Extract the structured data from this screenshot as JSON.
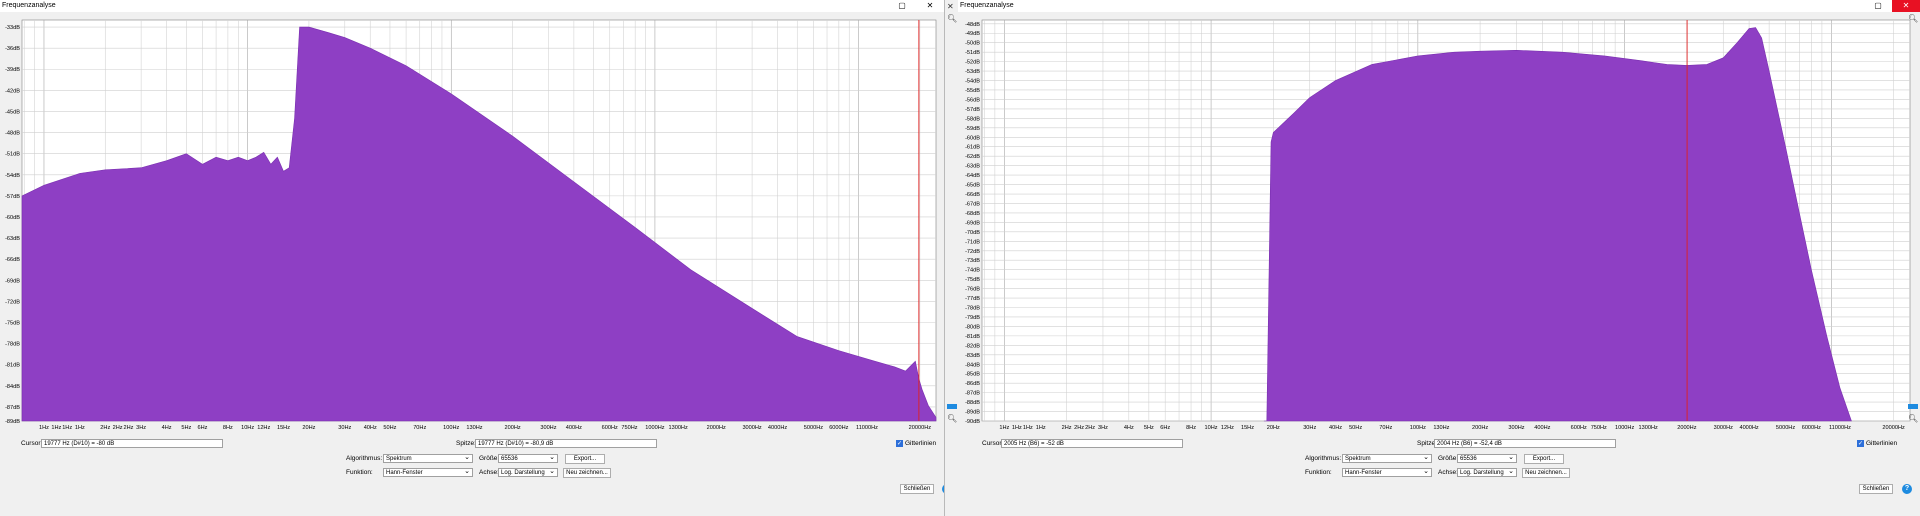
{
  "left": {
    "title": "Frequenzanalyse",
    "cursor_label": "Cursor:",
    "cursor_value": "19777 Hz (D#10) = -80 dB",
    "peak_label": "Spitze:",
    "peak_value": "19777 Hz (D#10) = -80,9 dB",
    "grid_label": "Gitterlinien",
    "algorithm_label": "Algorithmus:",
    "algorithm_value": "Spektrum",
    "size_label": "Größe:",
    "size_value": "65536",
    "export_label": "Export...",
    "function_label": "Funktion:",
    "function_value": "Hann-Fenster",
    "axis_label": "Achse:",
    "axis_value": "Log. Darstellung",
    "redraw_label": "Neu zeichnen...",
    "close_label": "Schließen",
    "help_label": "?"
  },
  "right": {
    "title": "Frequenzanalyse",
    "cursor_label": "Cursor:",
    "cursor_value": "2005 Hz (B6) = -52 dB",
    "peak_label": "Spitze:",
    "peak_value": "2004 Hz (B6) = -52,4 dB",
    "grid_label": "Gitterlinien",
    "algorithm_label": "Algorithmus:",
    "algorithm_value": "Spektrum",
    "size_label": "Größe:",
    "size_value": "65536",
    "export_label": "Export...",
    "function_label": "Funktion:",
    "function_value": "Hann-Fenster",
    "axis_label": "Achse:",
    "axis_value": "Log. Darstellung",
    "redraw_label": "Neu zeichnen...",
    "close_label": "Schließen",
    "help_label": "?"
  },
  "colors": {
    "spectrum_fill": "#8e3fc4",
    "cursor_line": "#e02020",
    "grid": "#c8c8c8",
    "accent": "#1e8be0"
  },
  "icons": {
    "maximize": "maximize-icon",
    "close": "close-icon",
    "zoom": "magnifier-icon"
  },
  "chart_data": [
    {
      "type": "area",
      "yticks": [
        "-33dB",
        "-36dB",
        "-39dB",
        "-42dB",
        "-45dB",
        "-48dB",
        "-51dB",
        "-54dB",
        "-57dB",
        "-60dB",
        "-63dB",
        "-66dB",
        "-69dB",
        "-72dB",
        "-75dB",
        "-78dB",
        "-81dB",
        "-84dB",
        "-87dB",
        "-89dB"
      ],
      "xticks": [
        "1Hz",
        "1Hz",
        "1Hz",
        "1Hz",
        "2Hz",
        "2Hz",
        "2Hz",
        "3Hz",
        "4Hz",
        "5Hz",
        "6Hz",
        "8Hz",
        "10Hz",
        "12Hz",
        "15Hz",
        "20Hz",
        "30Hz",
        "40Hz",
        "50Hz",
        "70Hz",
        "100Hz",
        "130Hz",
        "200Hz",
        "300Hz",
        "400Hz",
        "600Hz",
        "750Hz",
        "1000Hz",
        "1300Hz",
        "2000Hz",
        "3000Hz",
        "4000Hz",
        "5000Hz",
        "6000Hz",
        "11000Hz",
        "20000Hz"
      ],
      "ylim": [
        -89,
        -32
      ],
      "xlim_hz": [
        0.78,
        24000
      ],
      "x_scale": "log",
      "cursor_hz": 19777,
      "x": [
        0.78,
        1.0,
        1.5,
        2.0,
        3.0,
        4.0,
        5.0,
        6.0,
        7.0,
        8.0,
        9.0,
        10.0,
        11.0,
        12.0,
        13.0,
        14.0,
        15.0,
        16.0,
        17.0,
        18.0,
        20.0,
        25.0,
        30.0,
        40.0,
        60.0,
        100.0,
        200.0,
        400.0,
        800.0,
        1500.0,
        3000.0,
        5000.0,
        8000.0,
        12000.0,
        15000.0,
        17000.0,
        19000.0,
        19777.0,
        20500.0,
        22000.0,
        24000.0
      ],
      "y": [
        -57,
        -55.5,
        -53.8,
        -53.3,
        -53.0,
        -52.0,
        -51.0,
        -52.5,
        -51.5,
        -52.0,
        -51.5,
        -52.0,
        -51.5,
        -50.8,
        -52.5,
        -51.5,
        -53.5,
        -53.0,
        -46,
        -33.0,
        -33.0,
        -33.8,
        -34.5,
        -36.0,
        -38.5,
        -42.5,
        -48.5,
        -55.0,
        -61.5,
        -67.5,
        -73.0,
        -77.0,
        -79.0,
        -80.5,
        -81.3,
        -81.9,
        -80.5,
        -83.0,
        -84.5,
        -86.8,
        -88.5
      ]
    },
    {
      "type": "area",
      "yticks": [
        "-48dB",
        "-49dB",
        "-50dB",
        "-51dB",
        "-52dB",
        "-53dB",
        "-54dB",
        "-55dB",
        "-56dB",
        "-57dB",
        "-58dB",
        "-59dB",
        "-60dB",
        "-61dB",
        "-62dB",
        "-63dB",
        "-64dB",
        "-65dB",
        "-66dB",
        "-67dB",
        "-68dB",
        "-69dB",
        "-70dB",
        "-71dB",
        "-72dB",
        "-73dB",
        "-74dB",
        "-75dB",
        "-76dB",
        "-77dB",
        "-78dB",
        "-79dB",
        "-80dB",
        "-81dB",
        "-82dB",
        "-83dB",
        "-84dB",
        "-85dB",
        "-86dB",
        "-87dB",
        "-88dB",
        "-89dB",
        "-90dB"
      ],
      "xticks": [
        "1Hz",
        "1Hz",
        "1Hz",
        "1Hz",
        "2Hz",
        "2Hz",
        "2Hz",
        "3Hz",
        "4Hz",
        "5Hz",
        "6Hz",
        "8Hz",
        "10Hz",
        "12Hz",
        "15Hz",
        "20Hz",
        "30Hz",
        "40Hz",
        "50Hz",
        "70Hz",
        "100Hz",
        "130Hz",
        "200Hz",
        "300Hz",
        "400Hz",
        "600Hz",
        "750Hz",
        "1000Hz",
        "1300Hz",
        "2000Hz",
        "3000Hz",
        "4000Hz",
        "5000Hz",
        "6000Hz",
        "11000Hz",
        "20000Hz"
      ],
      "ylim": [
        -90,
        -47.6
      ],
      "xlim_hz": [
        0.78,
        24000
      ],
      "x_scale": "log",
      "cursor_hz": 2005,
      "x": [
        18.0,
        18.6,
        19.5,
        20.0,
        25.0,
        30.0,
        40.0,
        60.0,
        100.0,
        150.0,
        200.0,
        300.0,
        500.0,
        800.0,
        1200.0,
        1600.0,
        2000.0,
        2500.0,
        3000.0,
        3500.0,
        4000.0,
        4300.0,
        4600.0,
        5000.0,
        6000.0,
        7000.0,
        8000.0,
        9500.0,
        11000.0,
        12500.0
      ],
      "y": [
        -90,
        -90,
        -60.5,
        -59.5,
        -57.5,
        -55.8,
        -54.0,
        -52.3,
        -51.4,
        -51.0,
        -50.9,
        -50.8,
        -51.0,
        -51.4,
        -51.9,
        -52.3,
        -52.4,
        -52.3,
        -51.6,
        -50.0,
        -48.5,
        -48.4,
        -49.5,
        -53.0,
        -61.0,
        -68.0,
        -74.0,
        -81.0,
        -86.5,
        -90
      ]
    }
  ]
}
